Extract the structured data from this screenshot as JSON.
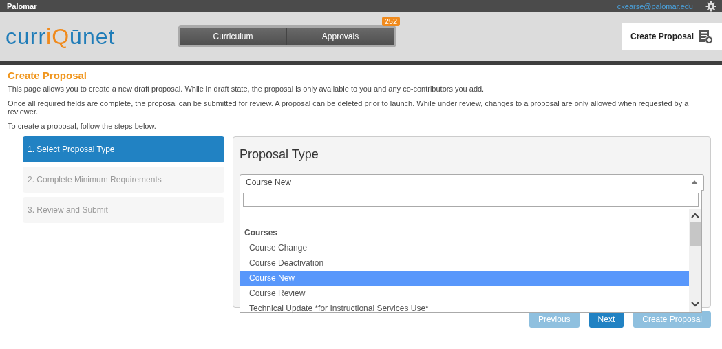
{
  "top_bar": {
    "org": "Palomar",
    "user": "ckearse@palomar.edu"
  },
  "header": {
    "logo": [
      {
        "text": "curr",
        "accent": false
      },
      {
        "text": "iQ",
        "accent": true
      },
      {
        "text": "ūnet",
        "accent": false
      }
    ],
    "nav": [
      {
        "label": "Curriculum"
      },
      {
        "label": "Approvals",
        "badge": "252"
      }
    ],
    "action": "Create Proposal"
  },
  "page": {
    "title": "Create Proposal",
    "paragraphs": [
      "This page allows you to create a new draft proposal. While in draft state, the proposal is only available to you and any co-contributors you add.",
      "Once all required fields are complete, the proposal can be submitted for review. A proposal can be deleted prior to launch. While under review, changes to a proposal are only allowed when requested by a reviewer.",
      "To create a proposal, follow the steps below."
    ]
  },
  "steps": [
    {
      "label": "1. Select Proposal Type",
      "selected": true
    },
    {
      "label": "2. Complete Minimum Requirements",
      "selected": false
    },
    {
      "label": "3. Review and Submit",
      "selected": false
    }
  ],
  "panel": {
    "title": "Proposal Type",
    "select_value": "Course New",
    "expanded": true,
    "options": [
      {
        "kind": "group",
        "label": "Courses"
      },
      {
        "kind": "option",
        "label": "Course Change",
        "selected": false
      },
      {
        "kind": "option",
        "label": "Course Deactivation",
        "selected": false
      },
      {
        "kind": "option",
        "label": "Course New",
        "selected": true
      },
      {
        "kind": "option",
        "label": "Course Review",
        "selected": false
      },
      {
        "kind": "option",
        "label": "Technical Update *for Instructional Services Use*",
        "selected": false
      }
    ]
  },
  "buttons": [
    {
      "label": "Previous",
      "disabled": true
    },
    {
      "label": "Next",
      "disabled": false
    },
    {
      "label": "Create Proposal",
      "disabled": true
    }
  ]
}
